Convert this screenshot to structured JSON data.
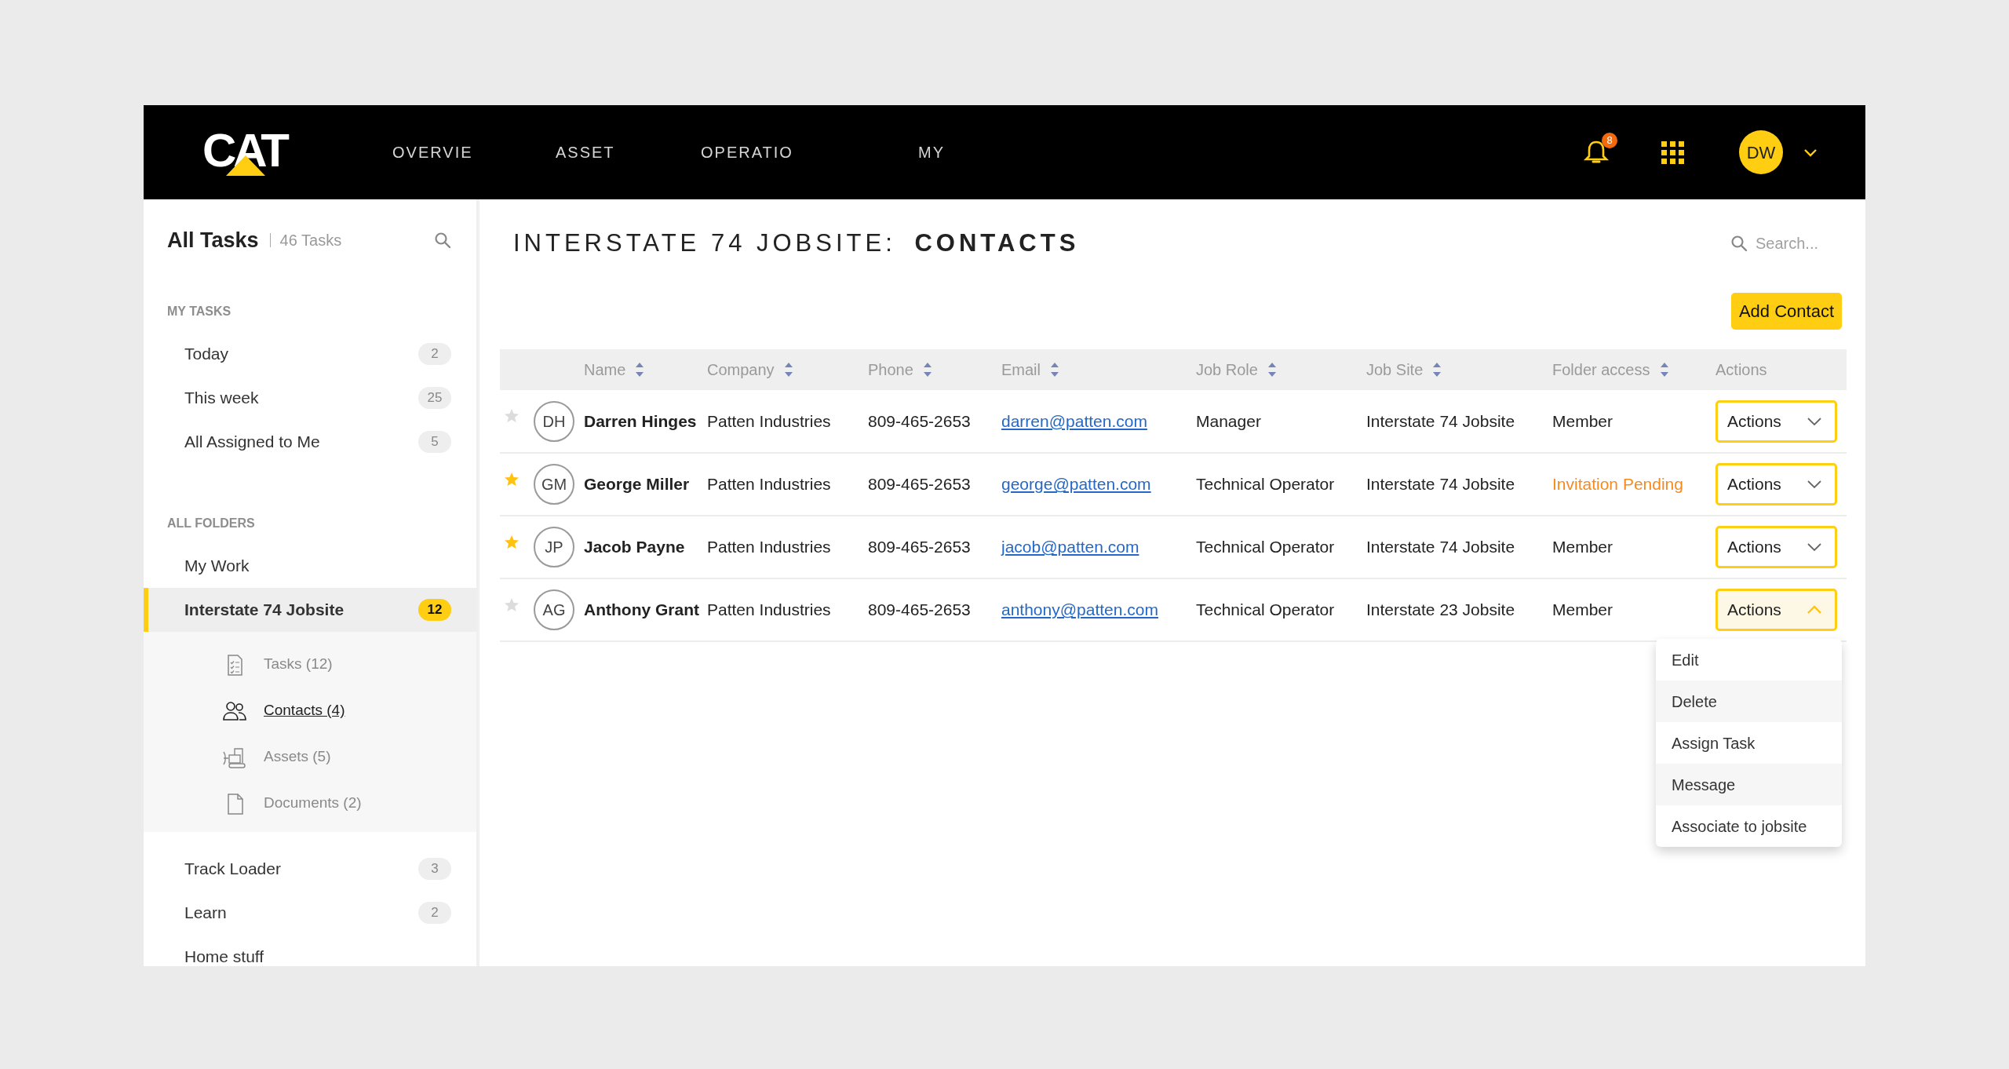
{
  "header": {
    "logo": "CAT",
    "nav": [
      "OVERVIE",
      "ASSET",
      "OPERATIO",
      "MY"
    ],
    "notification_count": "8",
    "user_initials": "DW"
  },
  "sidebar": {
    "title": "All Tasks",
    "task_count": "46 Tasks",
    "sections": [
      {
        "heading": "MY TASKS",
        "items": [
          {
            "label": "Today",
            "count": "2",
            "selected": false
          },
          {
            "label": "This week",
            "count": "25",
            "selected": false
          },
          {
            "label": "All Assigned to Me",
            "count": "5",
            "selected": false
          }
        ]
      },
      {
        "heading": "ALL FOLDERS",
        "items": [
          {
            "label": "My Work",
            "selected": false
          },
          {
            "label": "Interstate 74 Jobsite",
            "count": "12",
            "selected": true,
            "expanded": true,
            "children": [
              {
                "kind": "tasks",
                "label": "Tasks (12)",
                "selected": false
              },
              {
                "kind": "contacts",
                "label": "Contacts (4)",
                "selected": true
              },
              {
                "kind": "assets",
                "label": "Assets (5)",
                "selected": false
              },
              {
                "kind": "documents",
                "label": "Documents (2)",
                "selected": false
              }
            ]
          },
          {
            "label": "Track Loader",
            "count": "3",
            "selected": false
          },
          {
            "label": "Learn",
            "count": "2",
            "selected": false
          },
          {
            "label": "Home stuff",
            "selected": false
          }
        ]
      }
    ]
  },
  "main": {
    "title": "INTERSTATE 74 JOBSITE: **CONTACTS**",
    "search": {
      "placeholder": "Search..."
    },
    "add_button": "Add Contact",
    "table": {
      "columns": [
        {
          "label": "Name",
          "sortable": true
        },
        {
          "label": "Company",
          "sortable": true
        },
        {
          "label": "Phone",
          "sortable": true
        },
        {
          "label": "Email",
          "sortable": true
        },
        {
          "label": "Job Role",
          "sortable": true
        },
        {
          "label": "Job Site",
          "sortable": true
        },
        {
          "label": "Folder access",
          "sortable": true
        },
        {
          "label": "Actions",
          "sortable": false
        }
      ],
      "rows": [
        {
          "starred": false,
          "initials": "DH",
          "name": "Darren Hinges",
          "company": "Patten Industries",
          "phone": "809-465-2653",
          "email": "darren@patten.com",
          "job_role": "Manager",
          "job_site": "Interstate 74 Jobsite",
          "folder_access": "Member",
          "access_pending": false,
          "action": "Actions",
          "expanded": false
        },
        {
          "starred": true,
          "initials": "GM",
          "name": "George Miller",
          "company": "Patten Industries",
          "phone": "809-465-2653",
          "email": "george@patten.com",
          "job_role": "Technical Operator",
          "job_site": "Interstate 74 Jobsite",
          "folder_access": "Invitation Pending",
          "access_pending": true,
          "action": "Actions",
          "expanded": false
        },
        {
          "starred": true,
          "initials": "JP",
          "name": "Jacob Payne",
          "company": "Patten Industries",
          "phone": "809-465-2653",
          "email": "jacob@patten.com",
          "job_role": "Technical Operator",
          "job_site": "Interstate 74 Jobsite",
          "folder_access": "Member",
          "access_pending": false,
          "action": "Actions",
          "expanded": false
        },
        {
          "starred": false,
          "initials": "AG",
          "name": "Anthony Grant",
          "company": "Patten Industries",
          "phone": "809-465-2653",
          "email": "anthony@patten.com",
          "job_role": "Technical Operator",
          "job_site": "Interstate 23 Jobsite",
          "folder_access": "Member",
          "access_pending": false,
          "action": "Actions",
          "expanded": true
        }
      ],
      "action_menu": [
        "Edit",
        "Delete",
        "Assign Task",
        "Message",
        "Associate to jobsite"
      ]
    }
  }
}
